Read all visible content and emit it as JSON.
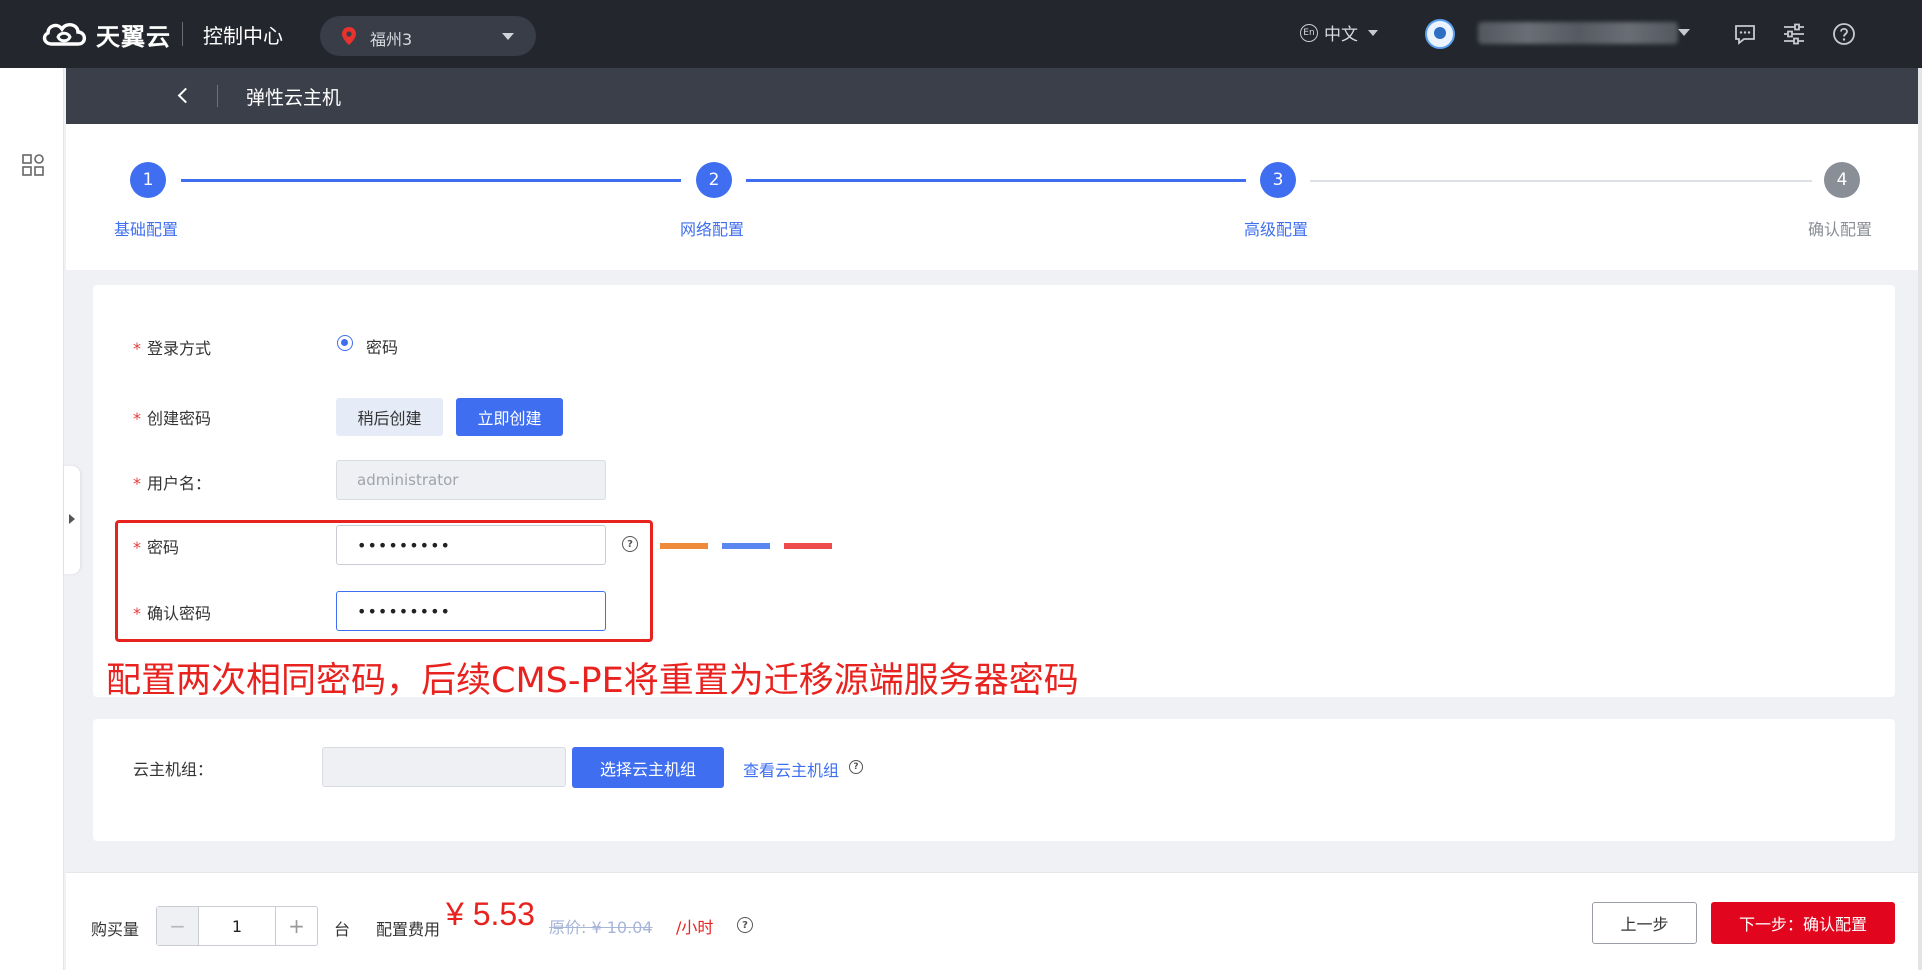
{
  "header": {
    "logo_text": "天翼云",
    "console_title": "控制中心",
    "region": "福州3",
    "language": "中文",
    "lang_badge": "En"
  },
  "subheader": {
    "title": "弹性云主机"
  },
  "steps": [
    {
      "number": "1",
      "label": "基础配置",
      "state": "done"
    },
    {
      "number": "2",
      "label": "网络配置",
      "state": "done"
    },
    {
      "number": "3",
      "label": "高级配置",
      "state": "current"
    },
    {
      "number": "4",
      "label": "确认配置",
      "state": "todo"
    }
  ],
  "form": {
    "login_method_label": "登录方式",
    "login_method_option": "密码",
    "create_password_label": "创建密码",
    "create_later_button": "稍后创建",
    "create_now_button": "立即创建",
    "username_label": "用户名：",
    "username_value": "administrator",
    "password_label": "密码",
    "password_value": "•••••••••",
    "confirm_password_label": "确认密码",
    "confirm_password_value": "•••••••••",
    "required_mark": "*"
  },
  "annotation": "配置两次相同密码，后续CMS-PE将重置为迁移源端服务器密码",
  "group": {
    "label": "云主机组：",
    "select_button": "选择云主机组",
    "view_link": "查看云主机组"
  },
  "footer": {
    "quantity_label": "购买量",
    "quantity_value": "1",
    "minus": "−",
    "plus": "+",
    "unit": "台",
    "fee_label": "配置费用",
    "price": "¥ 5.53",
    "original_price": "原价: ¥ 10.04",
    "per_hour": "/小时",
    "prev_button": "上一步",
    "next_button": "下一步：确认配置"
  },
  "colors": {
    "accent": "#3f6ff0",
    "header_bg": "#23262d",
    "subheader_bg": "#3a3f4a",
    "highlight": "#e8221f",
    "strength_weak": "#ef8a3a",
    "strength_mid": "#5a86ef",
    "strength_strong": "#ee4c4c",
    "primary_cta": "#e1061e"
  },
  "icons": {
    "logo": "cloud-logo-icon",
    "region": "location-pin-icon",
    "header_right": [
      "message-icon",
      "settings-sliders-icon",
      "help-circle-icon"
    ],
    "sidebar": "apps-grid-icon"
  }
}
